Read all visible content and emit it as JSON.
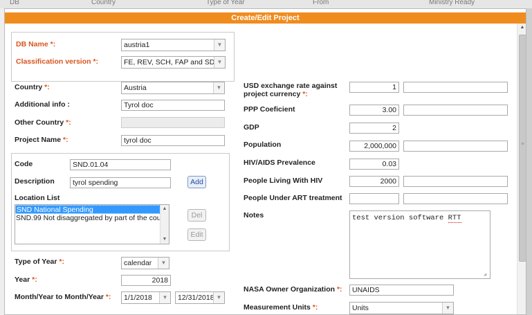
{
  "background": {
    "strip": [
      "DB",
      "Country",
      "Type of Year",
      "From",
      "Ministry Ready"
    ]
  },
  "dialog": {
    "title": "Create/Edit Project",
    "title_color": "#f08c1e"
  },
  "db_section": {
    "db_name_label": "DB Name",
    "db_name_value": "austria1",
    "classification_label": "Classification version",
    "classification_value": "FE, REV, SCH, FAP and SDM"
  },
  "left_fields": {
    "country_label": "Country",
    "country_value": "Austria",
    "additional_info_label": "Additional info :",
    "additional_info_value": "Tyrol doc",
    "other_country_label": "Other Country",
    "other_country_value": "",
    "project_name_label": "Project Name",
    "project_name_value": "tyrol doc"
  },
  "location_section": {
    "code_label": "Code",
    "code_value": "SND.01.04",
    "description_label": "Description",
    "description_value": "tyrol spending",
    "add_label": "Add",
    "list_label": "Location List",
    "items": [
      "SND National Spending",
      "SND.99 Not disaggregated by part of the cou"
    ],
    "del_label": "Del",
    "edit_label": "Edit"
  },
  "year_section": {
    "type_of_year_label": "Type of Year",
    "type_of_year_value": "calendar",
    "year_label": "Year",
    "year_value": "2018",
    "month_label": "Month/Year to Month/Year",
    "from_value": "1/1/2018",
    "to_value": "12/31/2018"
  },
  "right_fields": {
    "usd_label_line1": "USD exchange rate against",
    "usd_label_line2": "project currency",
    "usd_value": "1",
    "usd_extra": "",
    "ppp_label": "PPP Coeficient",
    "ppp_value": "3.00",
    "ppp_extra": "",
    "gdp_label": "GDP",
    "gdp_value": "2",
    "population_label": "Population",
    "population_value": "2,000,000",
    "population_extra": "",
    "hiv_prev_label": "HIV/AIDS Prevalence",
    "hiv_prev_value": "0.03",
    "plhiv_label": "People Living With HIV",
    "plhiv_value": "2000",
    "plhiv_extra": "",
    "art_label": "People Under ART treatment",
    "art_value": "",
    "art_extra": "",
    "notes_label": "Notes",
    "notes_text_main": "test version software ",
    "notes_text_flag": "RTT",
    "nasa_label": "NASA Owner Organization",
    "nasa_value": "UNAIDS",
    "measurement_label": "Measurement Units",
    "measurement_value": "Units"
  },
  "required_marker": " *:"
}
